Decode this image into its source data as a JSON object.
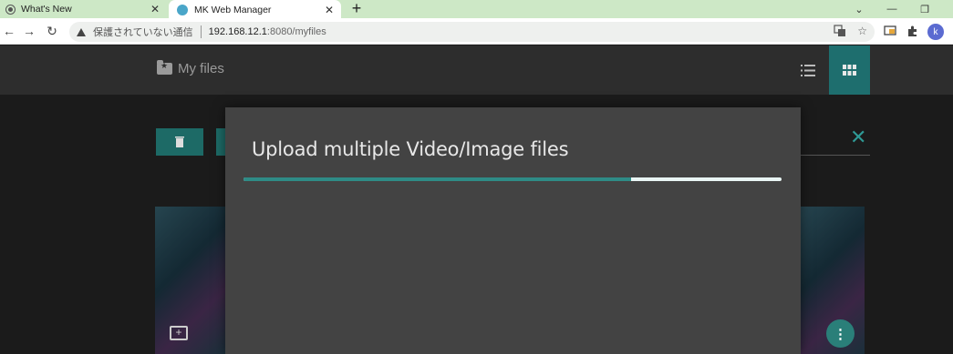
{
  "browser": {
    "tabs": [
      {
        "title": "What's New",
        "close": "✕"
      },
      {
        "title": "MK Web Manager",
        "close": "✕"
      }
    ],
    "new_tab": "+",
    "window_controls": {
      "minimize": "—",
      "restore": "❐",
      "dropdown": "⌄"
    },
    "address_bar": {
      "security_text": "保護されていない通信",
      "host": "192.168.12.1",
      "path": ":8080/myfiles"
    },
    "profile_initial": "k"
  },
  "app": {
    "title": "My files",
    "accent_color": "#1e6e6e"
  },
  "modal": {
    "title": "Upload multiple Video/Image files",
    "progress_percent": 72
  }
}
